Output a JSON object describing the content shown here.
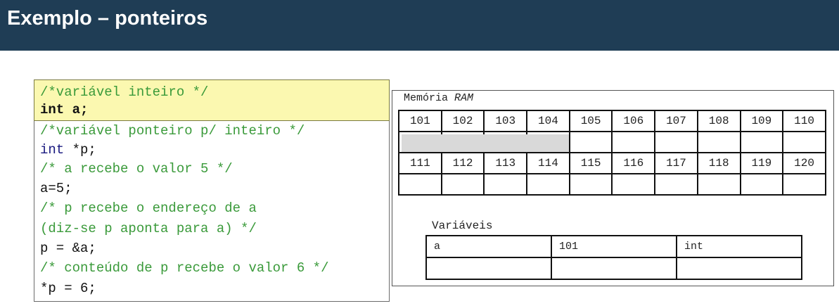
{
  "slide": {
    "title": "Exemplo – ponteiros"
  },
  "code": {
    "l1": "/*variável inteiro */",
    "l2a": "int",
    "l2b": " a;",
    "l3": "/*variável ponteiro p/ inteiro */",
    "l4a": "int",
    "l4b": " *p;",
    "l5": "/* a recebe o valor 5 */",
    "l6": "a=5;",
    "l7": "/* p recebe o endereço de a",
    "l8": "(diz-se p aponta para a) */",
    "l9": "p = &a;",
    "l10": "/* conteúdo de p recebe o valor 6 */",
    "l11": "*p = 6;"
  },
  "memory": {
    "label_a": "Memória ",
    "label_b": "RAM",
    "row1": [
      "101",
      "102",
      "103",
      "104",
      "105",
      "106",
      "107",
      "108",
      "109",
      "110"
    ],
    "row2": [
      "111",
      "112",
      "113",
      "114",
      "115",
      "116",
      "117",
      "118",
      "119",
      "120"
    ]
  },
  "variables": {
    "label": "Variáveis",
    "r1": [
      "a",
      "101",
      "int"
    ]
  },
  "colors": {
    "title_bar": "#1f3d55",
    "highlight": "#fbf8b0",
    "comment": "#3a9a3a",
    "shaded_cells": "#d9d9d9"
  }
}
